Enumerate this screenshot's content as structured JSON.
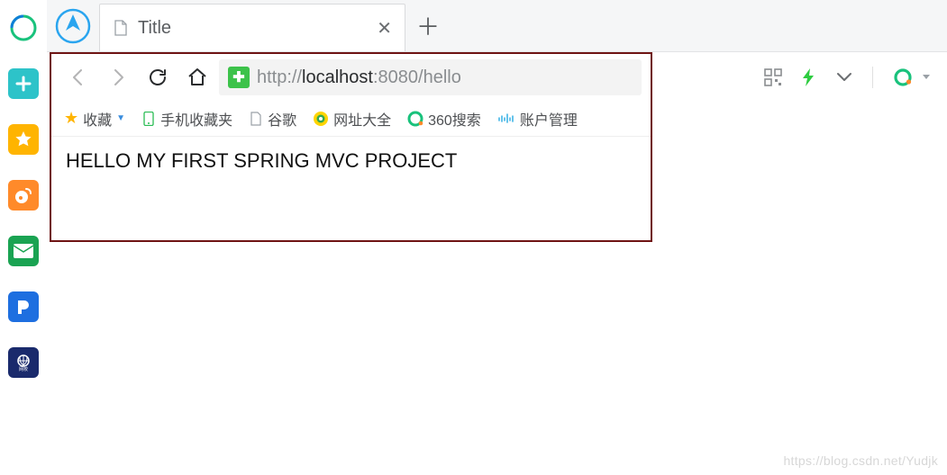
{
  "left_rail": {
    "items": [
      {
        "name": "browser-logo",
        "color": "#19c27c"
      },
      {
        "name": "plus-app",
        "color": "#2dc3c9"
      },
      {
        "name": "favorites-app",
        "color": "#ffb400"
      },
      {
        "name": "weibo-app",
        "color": "#ff8a2a"
      },
      {
        "name": "mail-app",
        "color": "#1aa352"
      },
      {
        "name": "pptv-app",
        "color": "#1e6fe0"
      },
      {
        "name": "globe-app",
        "color": "#1a2a6c"
      }
    ]
  },
  "tabstrip": {
    "nav_icon": "navigate-icon",
    "tab_title": "Title",
    "close_glyph": "✕",
    "newtab_glyph": "＋"
  },
  "address_bar": {
    "shield_glyph": "✚",
    "url_prefix": "http://",
    "url_host": "localhost",
    "url_rest": ":8080/hello"
  },
  "bookmarks_bar": {
    "fav_label": "收藏",
    "items": [
      {
        "icon": "phone",
        "label": "手机收藏夹"
      },
      {
        "icon": "doc",
        "label": "谷歌"
      },
      {
        "icon": "security",
        "label": "网址大全"
      },
      {
        "icon": "ring",
        "label": "360搜索"
      },
      {
        "icon": "cisco",
        "label": "账户管理"
      }
    ]
  },
  "page": {
    "body_text": "HELLO MY FIRST SPRING MVC PROJECT"
  },
  "right_tools": {
    "qr_icon": "qr-icon",
    "bolt_icon": "bolt-icon",
    "chevron_icon": "chevron-down-icon",
    "ring_icon": "ring-icon"
  },
  "watermark": "https://blog.csdn.net/Yudjk"
}
